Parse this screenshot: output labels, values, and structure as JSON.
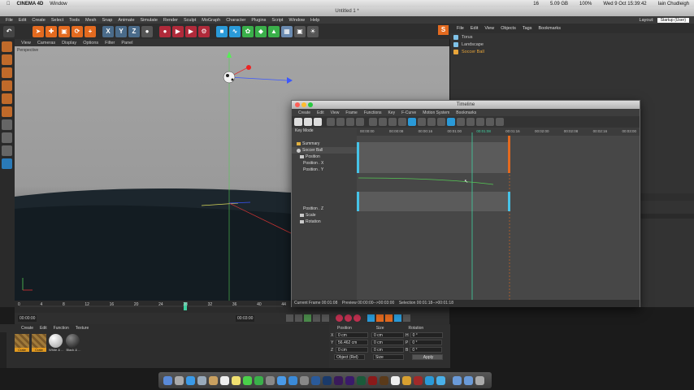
{
  "mac_menubar": {
    "apple": "",
    "app": "CINEMA 4D",
    "menu": "Window",
    "status_right": [
      "16",
      "5.09 GB",
      "100%",
      "Wed 9 Oct  15:39:42",
      "Iain Chudleigh"
    ]
  },
  "window_title": "Untitled 1 *",
  "main_menu": [
    "File",
    "Edit",
    "Create",
    "Select",
    "Tools",
    "Mesh",
    "Snap",
    "Animate",
    "Simulate",
    "Render",
    "Sculpt",
    "MoGraph",
    "Character",
    "Plugins",
    "Script",
    "Window",
    "Help"
  ],
  "layout": {
    "label": "Layout:",
    "value": "Startup (User)"
  },
  "toolbar_axes": [
    "X",
    "Y",
    "Z"
  ],
  "viewport": {
    "menu": [
      "View",
      "Cameras",
      "Display",
      "Options",
      "Filter",
      "Panel"
    ],
    "name": "Perspective"
  },
  "object_manager": {
    "menu": [
      "File",
      "Edit",
      "View",
      "Objects",
      "Tags",
      "Bookmarks"
    ],
    "objects": [
      {
        "name": "Torus",
        "color": "#7fc2e8"
      },
      {
        "name": "Landscape",
        "color": "#7fc2e8"
      },
      {
        "name": "Soccer Ball",
        "color": "#e8a53a"
      }
    ]
  },
  "timeline": {
    "title": "Timeline",
    "menu": [
      "Create",
      "Edit",
      "View",
      "Frame",
      "Functions",
      "Key",
      "F-Curve",
      "Motion System",
      "Bookmarks"
    ],
    "mode": "Key Mode",
    "ruler_labels": [
      "00:00:00",
      "00:00:08",
      "00:00:16",
      "00:01:00",
      "00:01:08",
      "00:01:16",
      "00:02:00",
      "00:02:08",
      "00:02:16",
      "00:03:00"
    ],
    "tracks": [
      "Summary",
      "Soccer Ball",
      "Position",
      "Position . X",
      "Position . Y",
      "Position . Z",
      "Scale",
      "Rotation"
    ],
    "status": {
      "current_frame": "Current Frame  00:01:08",
      "preview": "Preview  00:00:00-->00:03:00",
      "selection": "Selection  00:01:18-->00:01:18"
    }
  },
  "frame_ruler": [
    "0",
    "4",
    "8",
    "12",
    "16",
    "20",
    "24",
    "28",
    "32",
    "36",
    "40",
    "44"
  ],
  "transport": {
    "start": "00:00:00",
    "end": "00:03:00"
  },
  "material": {
    "menu": [
      "Create",
      "Edit",
      "Function",
      "Texture"
    ],
    "items": [
      "Crate",
      "Crate",
      "White & ...",
      "Black & ..."
    ]
  },
  "coordinates": {
    "headers": [
      "Position",
      "Size",
      "Rotation"
    ],
    "rows": [
      {
        "axis": "X",
        "pos": "0 cm",
        "size": "0 cm",
        "rot_label": "H",
        "rot": "0 °"
      },
      {
        "axis": "Y",
        "pos": "56.462 cm",
        "size": "0 cm",
        "rot_label": "P",
        "rot": "0 °"
      },
      {
        "axis": "Z",
        "pos": "0 cm",
        "size": "0 cm",
        "rot_label": "B",
        "rot": "0 °"
      }
    ],
    "mode": "Object (Rel)",
    "size_mode": "Size",
    "apply": "Apply"
  },
  "colors": {
    "accent_orange": "#e36a1f",
    "playhead": "#3fd0a0",
    "keyframe": "#46c3e8"
  }
}
